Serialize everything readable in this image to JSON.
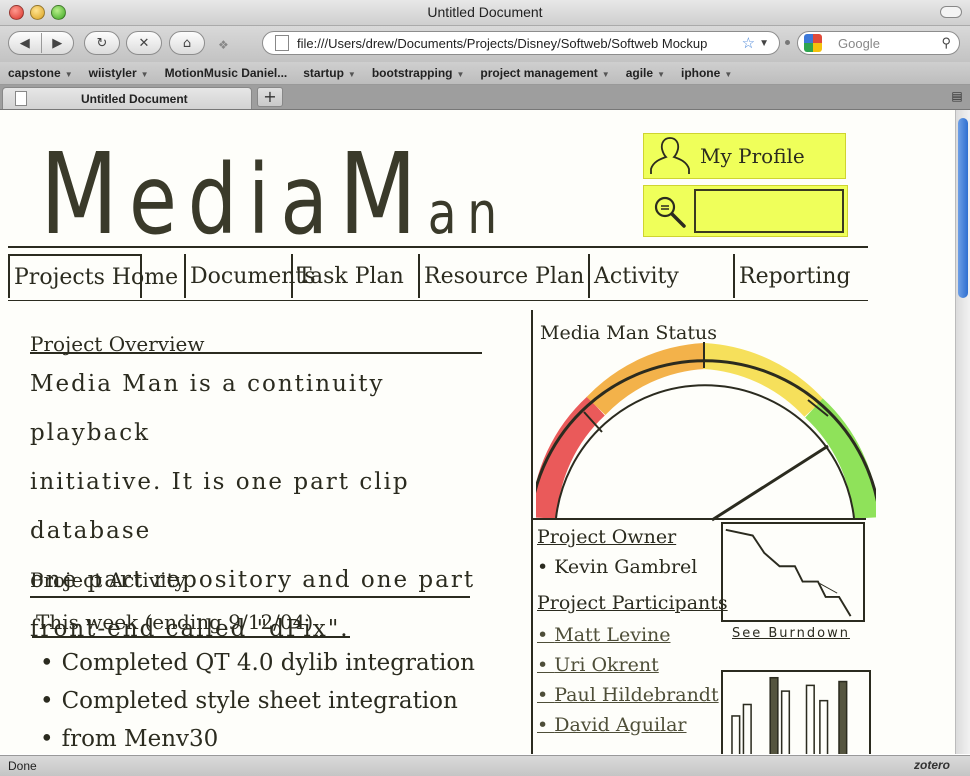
{
  "window": {
    "title": "Untitled Document"
  },
  "toolbar": {
    "url": "file:///Users/drew/Documents/Projects/Disney/Softweb/Softweb Mockup",
    "search_placeholder": "Google"
  },
  "bookmarks": [
    "capstone",
    "wiistyler",
    "MotionMusic Daniel...",
    "startup",
    "bootstrapping",
    "project management",
    "agile",
    "iphone"
  ],
  "tab": {
    "label": "Untitled Document"
  },
  "page": {
    "logo": "MediaMan",
    "logo_parts": [
      "M",
      "edia",
      "M",
      "an"
    ],
    "profile_label": "My Profile",
    "nav": [
      "Projects Home",
      "Documents",
      "Task Plan",
      "Resource Plan",
      "Activity",
      "Reporting"
    ],
    "overview_heading": "Project Overview",
    "overview_lines": [
      "Media Man is a continuity playback",
      "initiative. It is one part clip database",
      "one part repository and one part",
      "front-end called \"dPix\"."
    ],
    "activity_heading": "Project Activity",
    "activity_sub": "This week (ending 9/12/04)",
    "activity_items": [
      "Completed QT 4.0 dylib integration",
      "Completed style sheet integration",
      "from Menv30"
    ],
    "status_title": "Media Man Status",
    "owner_heading": "Project Owner",
    "owner": "Kevin Gambrel",
    "participants_heading": "Project Participants",
    "participants": [
      "Matt Levine",
      "Uri Okrent",
      "Paul Hildebrandt",
      "David Aguilar"
    ],
    "burndown_label": "See Burndown"
  },
  "statusbar": {
    "left": "Done",
    "right": "zotero"
  },
  "colors": {
    "highlight": "#efff5a",
    "gauge_red": "#ea5a5a",
    "gauge_orange": "#f3b24a",
    "gauge_yellow": "#f6e05b",
    "gauge_green": "#8fe25a",
    "scroll": "#3b7ad6"
  }
}
